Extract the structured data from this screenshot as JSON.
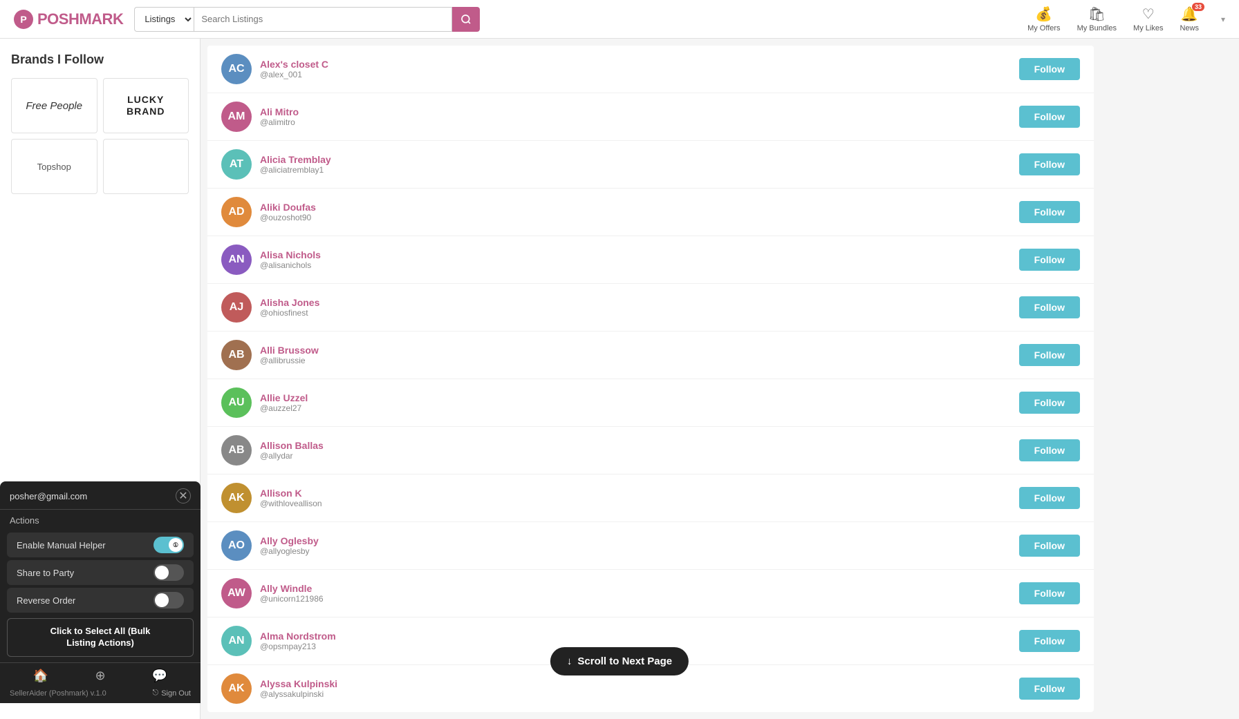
{
  "header": {
    "logo_text": "POSHMARK",
    "search_placeholder": "Search Listings",
    "search_dropdown": "Listings",
    "nav_items": [
      {
        "id": "my-offers",
        "label": "My Offers",
        "icon": "💰"
      },
      {
        "id": "my-bundles",
        "label": "My Bundles",
        "icon": "🛍"
      },
      {
        "id": "my-likes",
        "label": "My Likes",
        "icon": "♡"
      },
      {
        "id": "news",
        "label": "News",
        "icon": "🔔",
        "badge": "33"
      }
    ]
  },
  "sidebar": {
    "title": "Brands I Follow",
    "brands": [
      {
        "id": "free-people",
        "name": "Free People",
        "style": "italic"
      },
      {
        "id": "lucky-brand",
        "name": "LUCKY\nBRAND",
        "style": "bold"
      },
      {
        "id": "topshop",
        "name": "Topshop",
        "style": "normal"
      },
      {
        "id": "empty",
        "name": "",
        "style": "normal"
      }
    ]
  },
  "users": [
    {
      "id": 1,
      "name": "Alex's closet C",
      "handle": "@alex_001",
      "avatar_initials": "AC",
      "avatar_class": "av-blue",
      "follow_label": "Follow"
    },
    {
      "id": 2,
      "name": "Ali Mitro",
      "handle": "@alimitro",
      "avatar_initials": "AM",
      "avatar_class": "av-pink",
      "follow_label": "Follow"
    },
    {
      "id": 3,
      "name": "Alicia Tremblay",
      "handle": "@aliciatremblay1",
      "avatar_initials": "AT",
      "avatar_class": "av-teal",
      "follow_label": "Follow"
    },
    {
      "id": 4,
      "name": "Aliki Doufas",
      "handle": "@ouzoshot90",
      "avatar_initials": "AD",
      "avatar_class": "av-orange",
      "follow_label": "Follow"
    },
    {
      "id": 5,
      "name": "Alisa Nichols",
      "handle": "@alisanichols",
      "avatar_initials": "AN",
      "avatar_class": "av-purple",
      "follow_label": "Follow"
    },
    {
      "id": 6,
      "name": "Alisha Jones",
      "handle": "@ohiosfinest",
      "avatar_initials": "AJ",
      "avatar_class": "av-red",
      "follow_label": "Follow"
    },
    {
      "id": 7,
      "name": "Alli Brussow",
      "handle": "@allibrussie",
      "avatar_initials": "AB",
      "avatar_class": "av-brown",
      "follow_label": "Follow"
    },
    {
      "id": 8,
      "name": "Allie Uzzel",
      "handle": "@auzzel27",
      "avatar_initials": "AU",
      "avatar_class": "av-green",
      "follow_label": "Follow"
    },
    {
      "id": 9,
      "name": "Allison Ballas",
      "handle": "@allydar",
      "avatar_initials": "AB",
      "avatar_class": "av-gray",
      "follow_label": "Follow"
    },
    {
      "id": 10,
      "name": "Allison K",
      "handle": "@withloveallison",
      "avatar_initials": "AK",
      "avatar_class": "av-gold",
      "follow_label": "Follow"
    },
    {
      "id": 11,
      "name": "Ally Oglesby",
      "handle": "@allyoglesby",
      "avatar_initials": "AO",
      "avatar_class": "av-blue",
      "follow_label": "Follow"
    },
    {
      "id": 12,
      "name": "Ally Windle",
      "handle": "@unicorn121986",
      "avatar_initials": "AW",
      "avatar_class": "av-pink",
      "follow_label": "Follow"
    },
    {
      "id": 13,
      "name": "Alma Nordstrom",
      "handle": "@opsmpay213",
      "avatar_initials": "AN",
      "avatar_class": "av-teal",
      "follow_label": "Follow"
    },
    {
      "id": 14,
      "name": "Alyssa Kulpinski",
      "handle": "@alyssakulpinski",
      "avatar_initials": "AK",
      "avatar_class": "av-orange",
      "follow_label": "Follow"
    }
  ],
  "scroll_button": {
    "label": "Scroll to Next Page",
    "icon": "↓"
  },
  "panel": {
    "email": "posher@gmail.com",
    "section_title": "Actions",
    "toggle_manual_label": "Enable Manual Helper",
    "toggle_manual_on": true,
    "toggle_manual_badge": "①",
    "share_party_label": "Share to Party",
    "share_party_on": false,
    "reverse_order_label": "Reverse Order",
    "reverse_order_on": false,
    "select_all_label": "Click to Select All (Bulk\nListing Actions)",
    "footer_icons": [
      "🏠",
      "⊕",
      "💬"
    ],
    "version": "SellerAider (Poshmark) v.1.0",
    "signout_label": "Sign Out"
  }
}
